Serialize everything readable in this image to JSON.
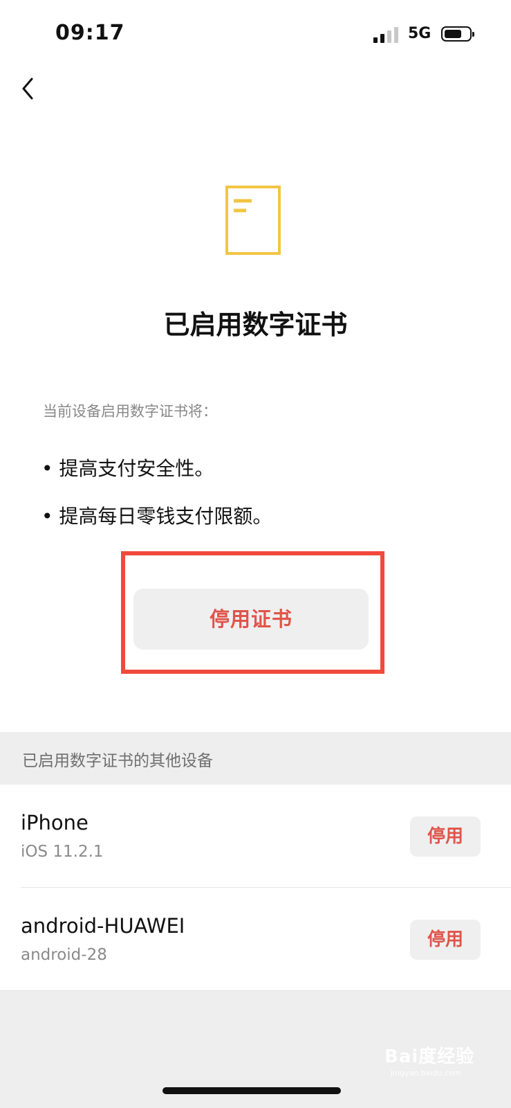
{
  "status_bar": {
    "time": "09:17",
    "network": "5G"
  },
  "header": {
    "back_icon": "chevron-left-icon"
  },
  "hero": {
    "icon": "document-icon",
    "icon_color": "#F2C542",
    "title": "已启用数字证书"
  },
  "description": {
    "subtitle": "当前设备启用数字证书将：",
    "bullets": [
      "• 提高支付安全性。",
      "• 提高每日零钱支付限额。"
    ]
  },
  "actions": {
    "disable_certificate_label": "停用证书"
  },
  "other_devices": {
    "section_title": "已启用数字证书的其他设备",
    "items": [
      {
        "name": "iPhone",
        "os": "iOS 11.2.1",
        "action_label": "停用"
      },
      {
        "name": "android-HUAWEI",
        "os": "android-28",
        "action_label": "停用"
      }
    ]
  },
  "watermark": {
    "text": "Bai度经验",
    "sub": "jingyan.baidu.com"
  },
  "colors": {
    "accent_red": "#E0544A",
    "highlight_border": "#F04A3C",
    "button_bg": "#EFEFEF",
    "section_bg": "#EEEEEE"
  }
}
